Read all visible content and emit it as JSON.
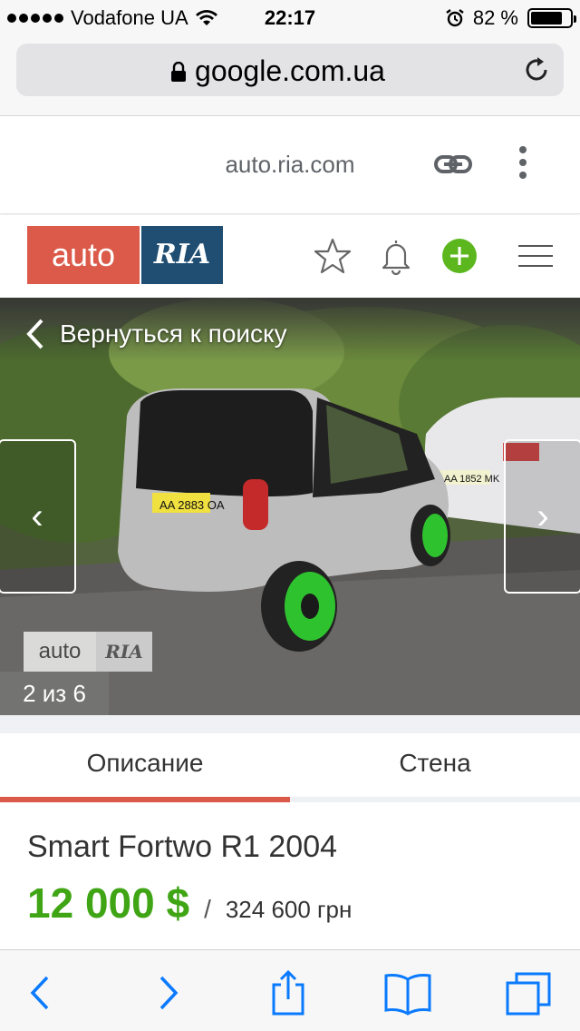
{
  "status_bar": {
    "carrier": "Vodafone UA",
    "time": "22:17",
    "battery": "82 %",
    "battery_level": 0.82
  },
  "browser": {
    "url": "google.com.ua"
  },
  "amp_header": {
    "domain": "auto.ria.com"
  },
  "site": {
    "logo_left": "auto",
    "logo_right": "RIA"
  },
  "gallery": {
    "back_label": "Вернуться к поиску",
    "prev_glyph": "‹",
    "next_glyph": "›",
    "watermark_left": "auto",
    "watermark_right": "RIA",
    "plate_front_car": "AA 2883 OA",
    "plate_other_car": "AA 1852 MK",
    "counter": "2 из 6"
  },
  "tabs": [
    {
      "label": "Описание",
      "active": true
    },
    {
      "label": "Стена",
      "active": false
    }
  ],
  "listing": {
    "title": "Smart Fortwo R1 2004",
    "price_usd": "12 000 $",
    "separator": "/",
    "price_uah": "324 600 грн"
  },
  "colors": {
    "brand_red": "#db5a49",
    "brand_blue": "#1f4e72",
    "price_green": "#3fa515",
    "add_green": "#5cb71f",
    "ios_blue": "#0a7aff"
  },
  "icons": {
    "header": [
      "star-icon",
      "bell-icon",
      "plus-icon",
      "menu-icon"
    ],
    "toolbar": [
      "back-arrow-icon",
      "forward-arrow-icon",
      "share-icon",
      "bookmarks-icon",
      "tabs-icon"
    ]
  }
}
